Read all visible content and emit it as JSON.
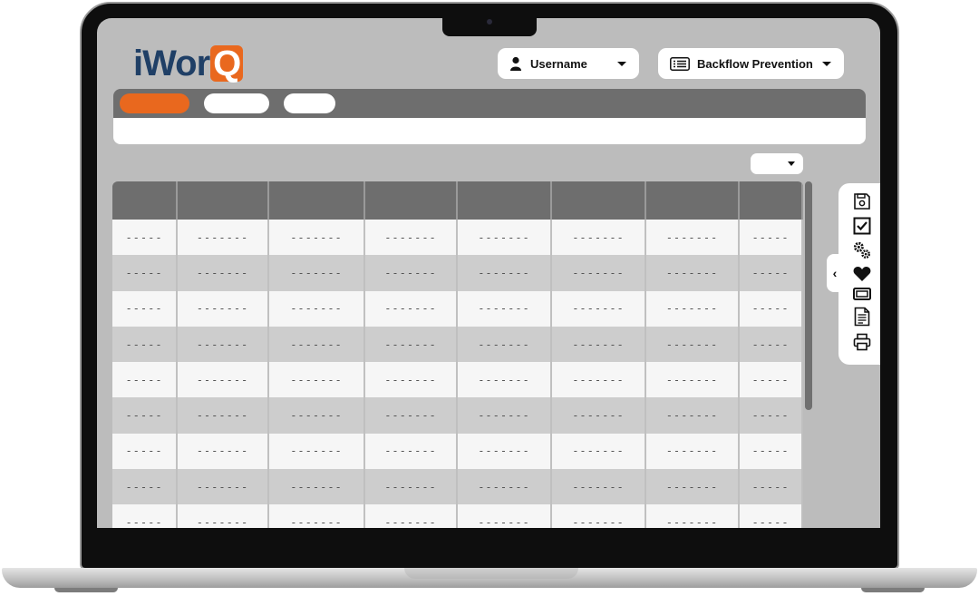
{
  "app": {
    "logo_text": "iWor",
    "logo_q": "Q"
  },
  "header": {
    "user_dropdown": {
      "label": "Username",
      "icon": "user-icon"
    },
    "module_dropdown": {
      "label": "Backflow Prevention",
      "icon": "list-icon"
    }
  },
  "tabs": [
    {
      "label": "",
      "active": true
    },
    {
      "label": "",
      "active": false
    },
    {
      "label": "",
      "active": false
    }
  ],
  "table": {
    "columns": [
      "",
      "",
      "",
      "",
      "",
      "",
      "",
      ""
    ],
    "rows": [
      [
        "-----",
        "-------",
        "-------",
        "-------",
        "-------",
        "-------",
        "-------",
        "-----"
      ],
      [
        "-----",
        "-------",
        "-------",
        "-------",
        "-------",
        "-------",
        "-------",
        "-----"
      ],
      [
        "-----",
        "-------",
        "-------",
        "-------",
        "-------",
        "-------",
        "-------",
        "-----"
      ],
      [
        "-----",
        "-------",
        "-------",
        "-------",
        "-------",
        "-------",
        "-------",
        "-----"
      ],
      [
        "-----",
        "-------",
        "-------",
        "-------",
        "-------",
        "-------",
        "-------",
        "-----"
      ],
      [
        "-----",
        "-------",
        "-------",
        "-------",
        "-------",
        "-------",
        "-------",
        "-----"
      ],
      [
        "-----",
        "-------",
        "-------",
        "-------",
        "-------",
        "-------",
        "-------",
        "-----"
      ],
      [
        "-----",
        "-------",
        "-------",
        "-------",
        "-------",
        "-------",
        "-------",
        "-----"
      ],
      [
        "-----",
        "-------",
        "-------",
        "-------",
        "-------",
        "-------",
        "-------",
        "-----"
      ]
    ]
  },
  "toolbar": {
    "collapse_glyph": "‹",
    "icons": [
      "save-icon",
      "checkbox-icon",
      "gears-icon",
      "heart-icon",
      "ticket-icon",
      "document-icon",
      "print-icon"
    ]
  },
  "colors": {
    "accent": "#e9681e",
    "brand": "#1f3f66",
    "header_gray": "#6e6e6e"
  }
}
